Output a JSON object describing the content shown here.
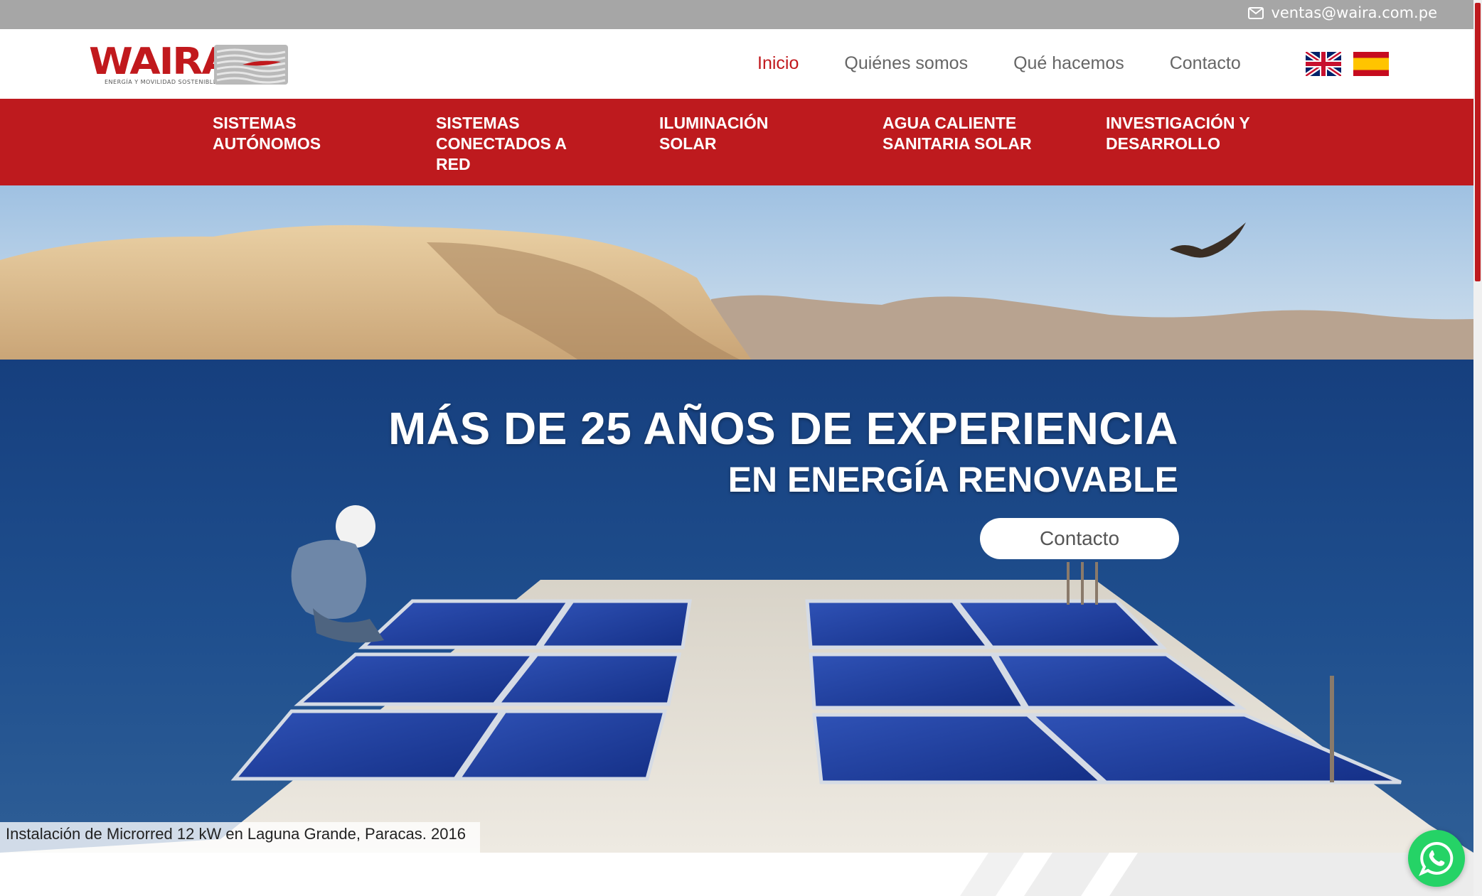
{
  "topbar": {
    "email_icon": "envelope-icon",
    "email": "ventas@waira.com.pe"
  },
  "header": {
    "logo": {
      "brand": "WAIRA",
      "tagline": "ENERGÍA Y MOVILIDAD SOSTENIBLE"
    },
    "nav": [
      {
        "label": "Inicio",
        "active": true
      },
      {
        "label": "Quiénes somos",
        "active": false
      },
      {
        "label": "Qué hacemos",
        "active": false
      },
      {
        "label": "Contacto",
        "active": false
      }
    ],
    "languages": [
      {
        "icon": "uk-flag-icon",
        "lang": "en"
      },
      {
        "icon": "spain-flag-icon",
        "lang": "es"
      }
    ]
  },
  "categories": [
    {
      "label": "Sistemas autónomos"
    },
    {
      "label": "Sistemas conectados a red"
    },
    {
      "label": "Iluminación solar"
    },
    {
      "label": "Agua caliente sanitaria solar"
    },
    {
      "label": "Investigación y desarrollo"
    }
  ],
  "hero": {
    "title": "MÁS DE 25 AÑOS DE EXPERIENCIA",
    "subtitle": "EN ENERGÍA RENOVABLE",
    "cta_label": "Contacto",
    "caption": "Instalación de Microrred 12 kW en Laguna Grande, Paracas. 2016"
  },
  "widgets": {
    "whatsapp_icon": "whatsapp-icon"
  },
  "colors": {
    "brand_red": "#be1a1e",
    "topbar_gray": "#a6a6a6",
    "whatsapp_green": "#25d366"
  }
}
